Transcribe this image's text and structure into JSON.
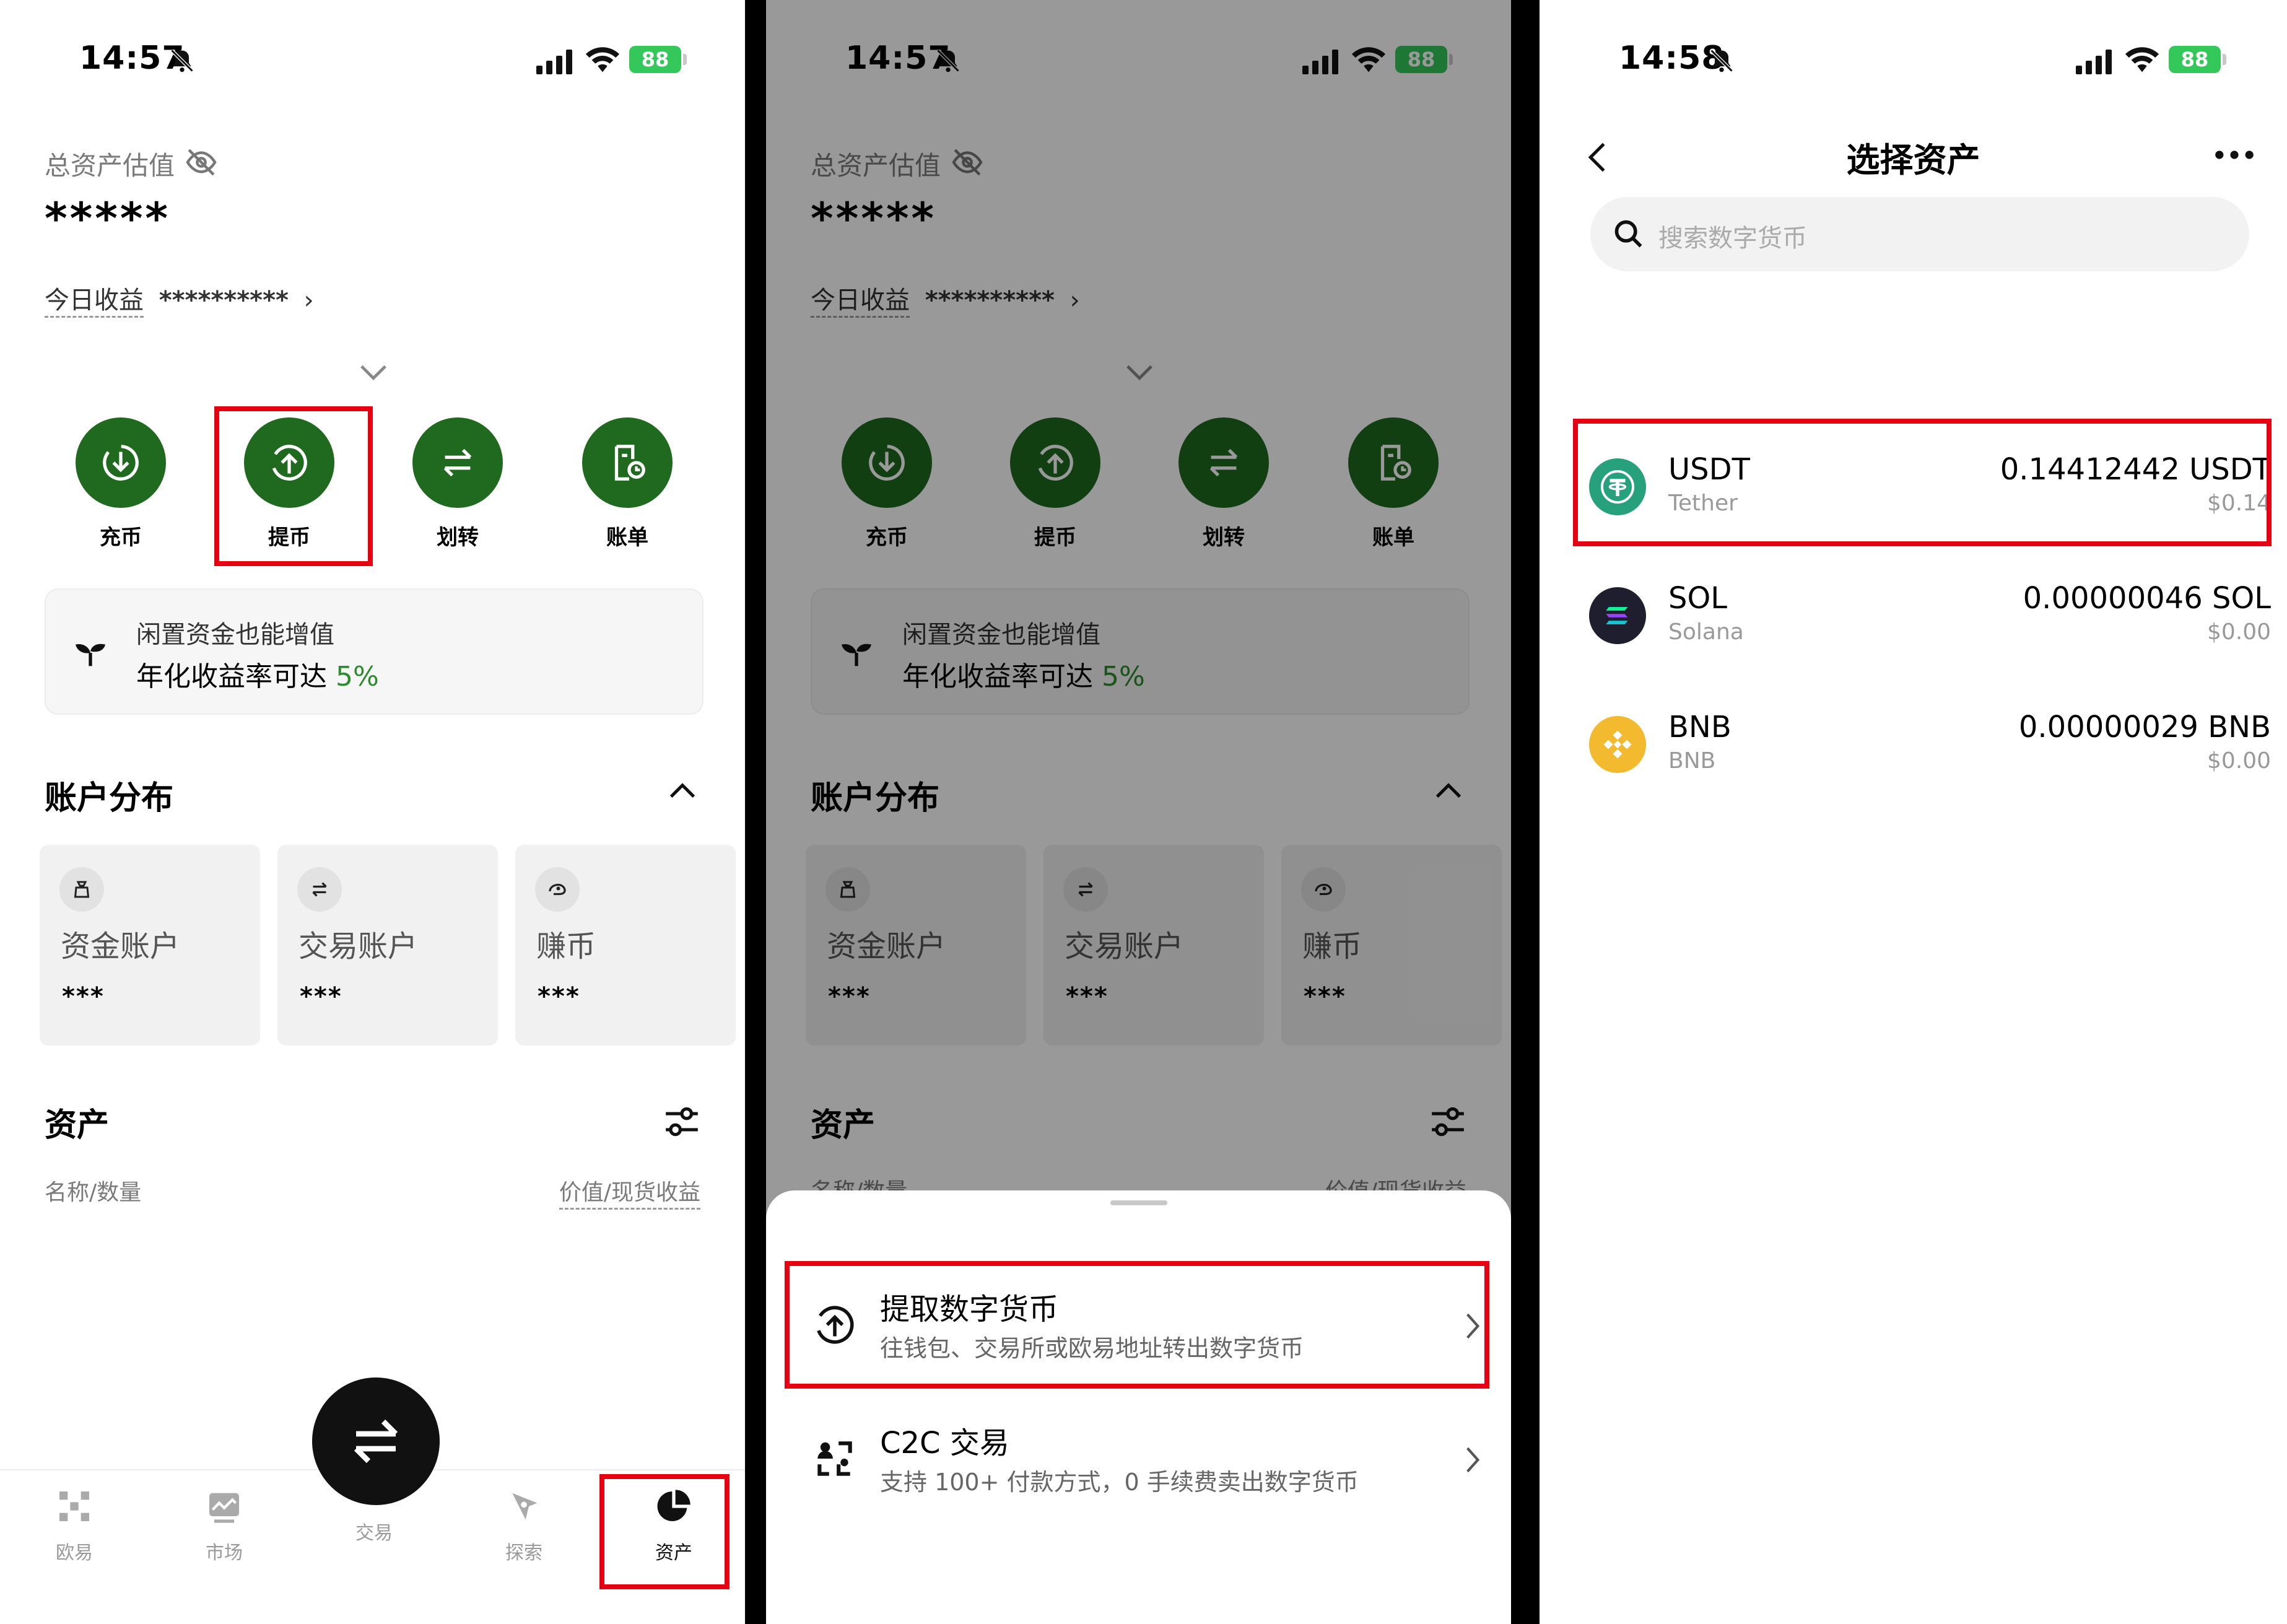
{
  "status": {
    "time_1": "14:57",
    "time_2": "14:57",
    "time_3": "14:58",
    "battery": "88"
  },
  "assets_home": {
    "total_label": "总资产估值",
    "total_value": "*****",
    "today_label": "今日收益",
    "today_value": "**********",
    "actions": [
      {
        "label": "充币",
        "icon": "deposit-icon"
      },
      {
        "label": "提币",
        "icon": "withdraw-icon"
      },
      {
        "label": "划转",
        "icon": "transfer-icon"
      },
      {
        "label": "账单",
        "icon": "bill-icon"
      }
    ],
    "promo_line1": "闲置资金也能增值",
    "promo_line2_prefix": "年化收益率可达 ",
    "promo_rate": "5%",
    "accounts_title": "账户分布",
    "accounts": [
      {
        "name": "资金账户",
        "value": "***",
        "icon": "bag-icon"
      },
      {
        "name": "交易账户",
        "value": "***",
        "icon": "swap-icon"
      },
      {
        "name": "赚币",
        "value": "***",
        "icon": "earn-icon"
      }
    ],
    "assets_title": "资产",
    "col_left": "名称/数量",
    "col_right": "价值/现货收益",
    "col_right_partial": "价值/现货收益"
  },
  "tabbar": [
    {
      "label": "欧易",
      "icon": "okx-logo-icon"
    },
    {
      "label": "市场",
      "icon": "market-chart-icon"
    },
    {
      "label": "交易",
      "icon": "trade-swap-icon"
    },
    {
      "label": "探索",
      "icon": "explore-icon"
    },
    {
      "label": "资产",
      "icon": "assets-pie-icon"
    }
  ],
  "sheet": {
    "item1_title": "提取数字货币",
    "item1_desc": "往钱包、交易所或欧易地址转出数字货币",
    "item2_title": "C2C 交易",
    "item2_desc": "支持 100+ 付款方式，0 手续费卖出数字货币"
  },
  "select_asset": {
    "title": "选择资产",
    "search_placeholder": "搜索数字货币",
    "coins": [
      {
        "symbol": "USDT",
        "name": "Tether",
        "amount": "0.14412442 USDT",
        "usd": "$0.14",
        "color": "#26a17b"
      },
      {
        "symbol": "SOL",
        "name": "Solana",
        "amount": "0.00000046 SOL",
        "usd": "$0.00",
        "color": "#1e1e2e"
      },
      {
        "symbol": "BNB",
        "name": "BNB",
        "amount": "0.00000029 BNB",
        "usd": "$0.00",
        "color": "#f3ba2f"
      }
    ]
  },
  "colors": {
    "accent_green": "#1f6a1f",
    "highlight_red": "#e60012",
    "positive_green": "#2e8b2e"
  }
}
